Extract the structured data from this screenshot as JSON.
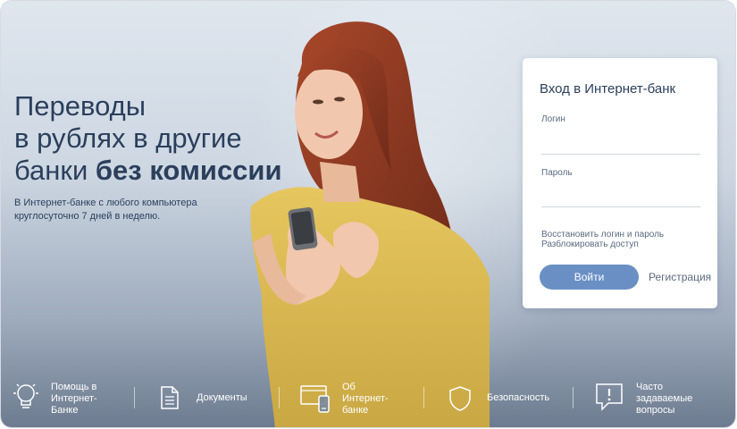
{
  "hero": {
    "title_line1": "Переводы",
    "title_line2": "в рублях в другие",
    "title_line3_plain": "банки ",
    "title_line3_bold": "без комиссии",
    "subtitle_line1": "В Интернет-банке с любого компьютера",
    "subtitle_line2": "круглосуточно 7 дней в неделю."
  },
  "login": {
    "title": "Вход в Интернет-банк",
    "login_label": "Логин",
    "password_label": "Пароль",
    "restore_link": "Восстановить логин и пароль",
    "unblock_link": "Разблокировать доступ",
    "submit_label": "Войти",
    "register_label": "Регистрация"
  },
  "bottom_bar": {
    "items": [
      {
        "icon": "lightbulb-icon",
        "line1": "Помощь в",
        "line2": "Интернет-",
        "line3": "Банке"
      },
      {
        "icon": "document-icon",
        "line1": "Документы",
        "line2": "",
        "line3": ""
      },
      {
        "icon": "devices-icon",
        "line1": "Об",
        "line2": "Интернет-",
        "line3": "банке"
      },
      {
        "icon": "shield-icon",
        "line1": "Безопасность",
        "line2": "",
        "line3": ""
      },
      {
        "icon": "question-bubble-icon",
        "line1": "Часто",
        "line2": "задаваемые",
        "line3": "вопросы"
      }
    ]
  },
  "colors": {
    "accent": "#6a8fc4",
    "text_dark": "#2b3f5c",
    "background_top": "#dfe6ee",
    "background_bottom": "#6d7b90"
  }
}
